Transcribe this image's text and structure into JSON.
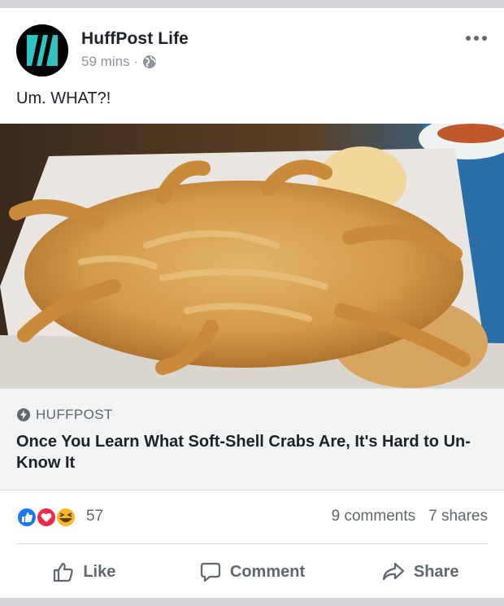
{
  "post": {
    "page_name": "HuffPost Life",
    "time": "59 mins",
    "separator": "·",
    "text": "Um. WHAT?!"
  },
  "link": {
    "source": "HUFFPOST",
    "headline": "Once You Learn What Soft-Shell Crabs Are, It's Hard to Un-Know It"
  },
  "stats": {
    "reaction_count": "57",
    "comments": "9 comments",
    "shares": "7 shares"
  },
  "actions": {
    "like": "Like",
    "comment": "Comment",
    "share": "Share"
  },
  "colors": {
    "avatar_accent": "#2ec4c4",
    "like_blue": "#1877f2",
    "love_red": "#f0284a",
    "haha_yellow": "#f7b928",
    "secondary_text": "#606770"
  },
  "icons": [
    "huffpost-logo-icon",
    "more-options-icon",
    "globe-icon",
    "bolt-icon",
    "like-reaction-icon",
    "love-reaction-icon",
    "haha-reaction-icon",
    "thumbs-up-icon",
    "comment-icon",
    "share-arrow-icon"
  ]
}
